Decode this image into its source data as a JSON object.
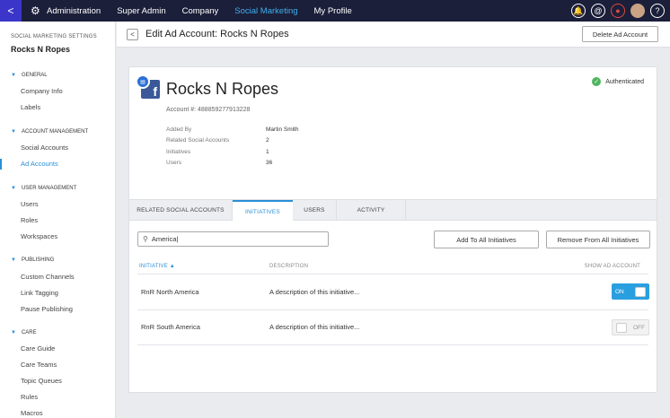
{
  "topnav": {
    "items": [
      "Administration",
      "Super Admin",
      "Company",
      "Social Marketing",
      "My Profile"
    ],
    "active_index": 3,
    "right_icons": [
      "bell-icon",
      "at-icon",
      "alert-icon",
      "avatar",
      "help-icon"
    ],
    "help_label": "?",
    "at_label": "@"
  },
  "sidebar": {
    "caption": "SOCIAL MARKETING SETTINGS",
    "title": "Rocks N Ropes",
    "sections": [
      {
        "label": "GENERAL",
        "items": [
          "Company Info",
          "Labels"
        ]
      },
      {
        "label": "ACCOUNT MANAGEMENT",
        "items": [
          "Social Accounts",
          "Ad Accounts"
        ]
      },
      {
        "label": "USER MANAGEMENT",
        "items": [
          "Users",
          "Roles",
          "Workspaces"
        ]
      },
      {
        "label": "PUBLISHING",
        "items": [
          "Custom Channels",
          "Link Tagging",
          "Pause Publishing"
        ]
      },
      {
        "label": "CARE",
        "items": [
          "Care Guide",
          "Care Teams",
          "Topic Queues",
          "Rules",
          "Macros"
        ]
      }
    ],
    "active_item": "Ad Accounts"
  },
  "header": {
    "title": "Edit Ad Account: Rocks N Ropes",
    "delete_label": "Delete Ad Account"
  },
  "account": {
    "name": "Rocks N Ropes",
    "number": "Account #: 488859277913228",
    "status": "Authenticated",
    "fb_letter": "f",
    "details": [
      {
        "label": "Added By",
        "value": "Martin Smith"
      },
      {
        "label": "Related Social Accounts",
        "value": "2"
      },
      {
        "label": "Initiatives",
        "value": "1"
      },
      {
        "label": "Users",
        "value": "36"
      }
    ]
  },
  "tabs": [
    "RELATED SOCIAL ACCOUNTS",
    "INITIATIVES",
    "USERS",
    "ACTIVITY"
  ],
  "active_tab": "INITIATIVES",
  "search": {
    "value": "America|"
  },
  "actions": {
    "add_all": "Add To All Initiatives",
    "remove_all": "Remove From All Initiatives"
  },
  "table": {
    "headers": {
      "initiative": "INITIATIVE ▲",
      "description": "DESCRIPTION",
      "show": "SHOW AD ACCOUNT"
    },
    "rows": [
      {
        "initiative": "RnR North America",
        "description": "A description of this initiative...",
        "toggle": "ON",
        "on": true
      },
      {
        "initiative": "RnR South America",
        "description": "A description of this initiative...",
        "toggle": "OFF",
        "on": false
      }
    ]
  },
  "colors": {
    "nav_bg": "#1c1f3a",
    "accent": "#2a8fd6",
    "toggle_on": "#2a9fe0",
    "authenticated": "#4fb55e",
    "facebook": "#3b5998"
  }
}
